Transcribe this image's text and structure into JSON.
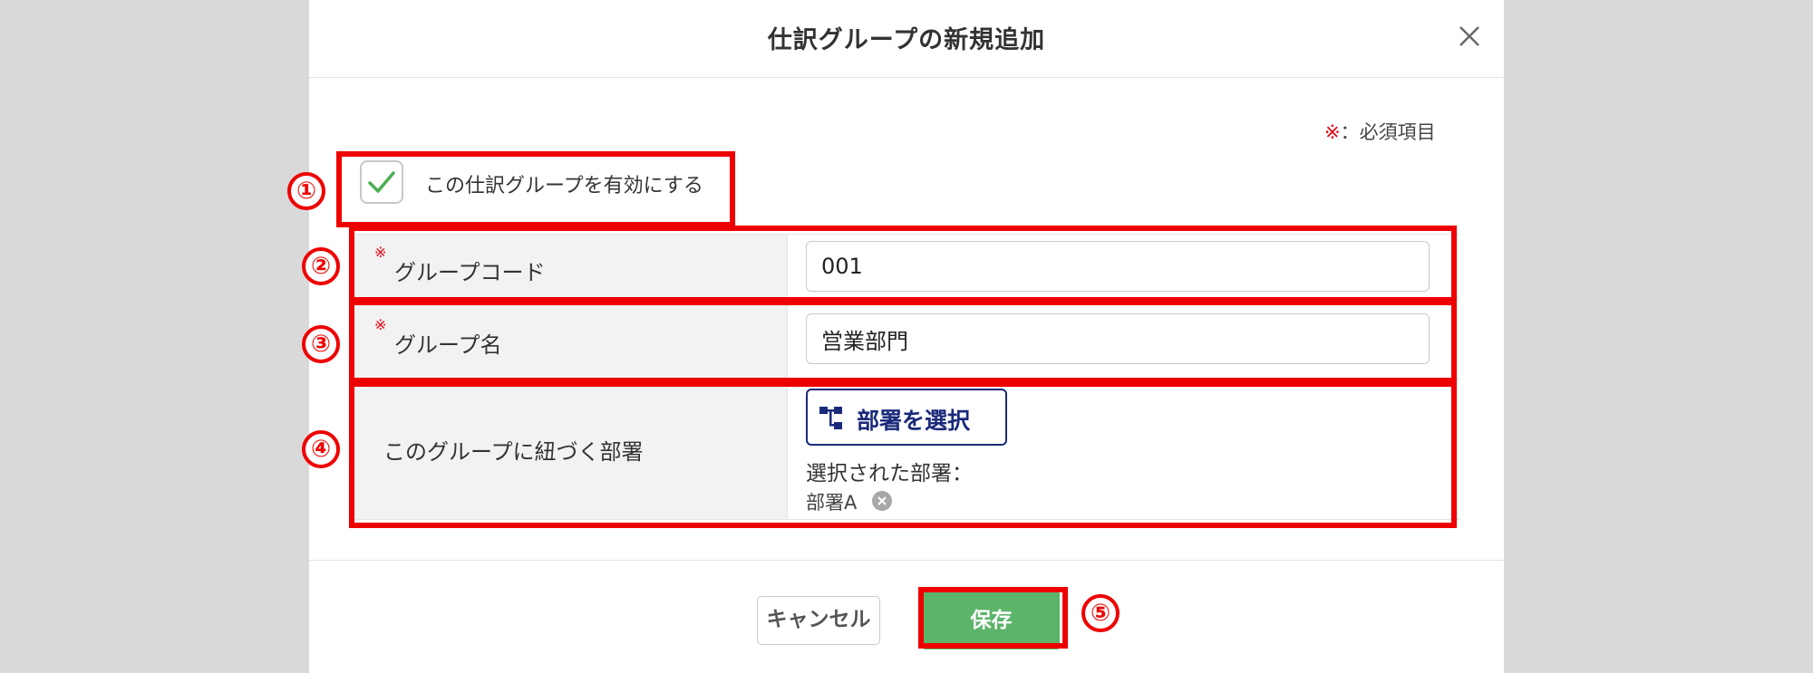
{
  "dialog": {
    "title": "仕訳グループの新規追加",
    "close_icon": "close-icon",
    "required_mark": "※",
    "required_note": "：必須項目"
  },
  "active_checkbox": {
    "checked": true,
    "label": "この仕訳グループを有効にする"
  },
  "form": {
    "group_code": {
      "label": "グループコード",
      "required_mark": "※",
      "value": "001"
    },
    "group_name": {
      "label": "グループ名",
      "required_mark": "※",
      "value": "営業部門"
    },
    "departments": {
      "label": "このグループに紐づく部署",
      "select_button": "部署を選択",
      "select_icon": "org-tree-icon",
      "selected_label": "選択された部署：",
      "selected": [
        "部署A"
      ]
    }
  },
  "footer": {
    "cancel": "キャンセル",
    "save": "保存"
  },
  "annotations": [
    "①",
    "②",
    "③",
    "④",
    "⑤"
  ],
  "colors": {
    "annotation": "#ee0000",
    "required": "#e60012",
    "save_button": "#5cb46a",
    "dept_button": "#1a2a7a",
    "check": "#4caf50"
  }
}
